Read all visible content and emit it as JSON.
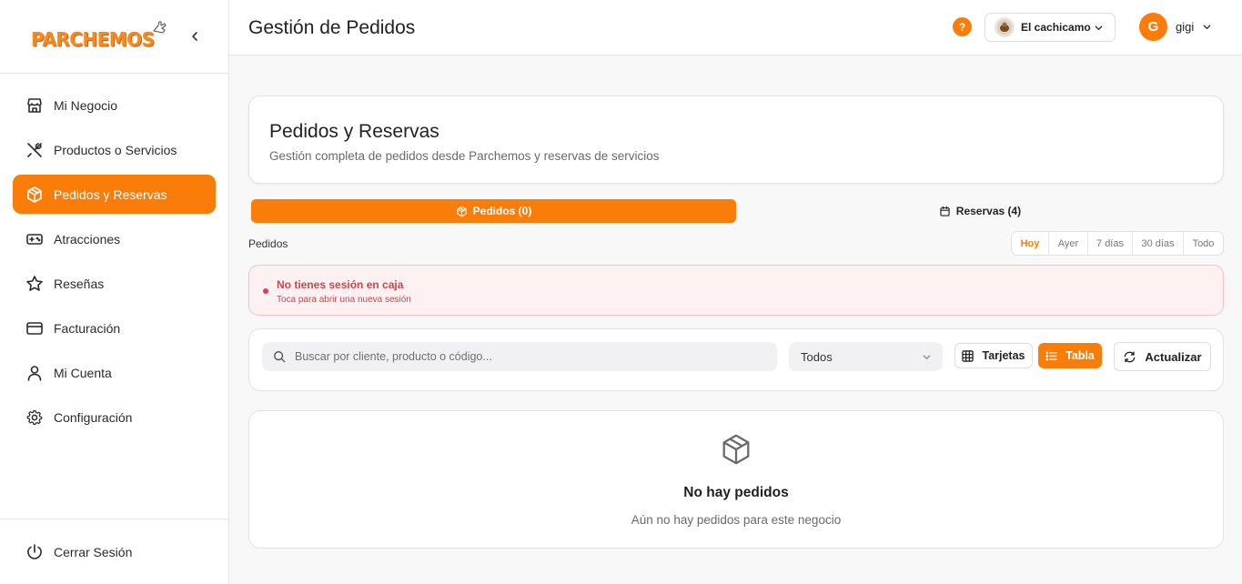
{
  "brand": {
    "logo_text": "PARCHEMOS",
    "accent": "#fb7d09"
  },
  "sidebar": {
    "items": [
      {
        "label": "Mi Negocio",
        "icon": "store-icon",
        "active": false
      },
      {
        "label": "Productos o Servicios",
        "icon": "utensils-icon",
        "active": false
      },
      {
        "label": "Pedidos y Reservas",
        "icon": "package-icon",
        "active": true
      },
      {
        "label": "Atracciones",
        "icon": "gamepad-icon",
        "active": false
      },
      {
        "label": "Reseñas",
        "icon": "star-icon",
        "active": false
      },
      {
        "label": "Facturación",
        "icon": "credit-card-icon",
        "active": false
      },
      {
        "label": "Mi Cuenta",
        "icon": "user-icon",
        "active": false
      },
      {
        "label": "Configuración",
        "icon": "gear-icon",
        "active": false
      }
    ],
    "logout_label": "Cerrar Sesión"
  },
  "header": {
    "title": "Gestión de Pedidos",
    "help_label": "?",
    "business_name": "El cachicamo",
    "user_initial": "G",
    "user_name": "gigi"
  },
  "hero": {
    "title": "Pedidos y Reservas",
    "subtitle": "Gestión completa de pedidos desde Parchemos y reservas de servicios"
  },
  "tabs": [
    {
      "label": "Pedidos (0)",
      "icon": "package-icon",
      "active": true
    },
    {
      "label": "Reservas (4)",
      "icon": "calendar-icon",
      "active": false
    }
  ],
  "section_label": "Pedidos",
  "range": {
    "options": [
      "Hoy",
      "Ayer",
      "7 días",
      "30 días",
      "Todo"
    ],
    "selected": "Hoy"
  },
  "alert": {
    "title": "No tienes sesión en caja",
    "subtitle": "Toca para abrir una nueva sesión"
  },
  "toolbar": {
    "search_placeholder": "Buscar por cliente, producto o código...",
    "search_value": "",
    "filter_value": "Todos",
    "cards_label": "Tarjetas",
    "table_label": "Tabla",
    "refresh_label": "Actualizar"
  },
  "empty_state": {
    "title": "No hay pedidos",
    "subtitle": "Aún no hay pedidos para este negocio"
  }
}
